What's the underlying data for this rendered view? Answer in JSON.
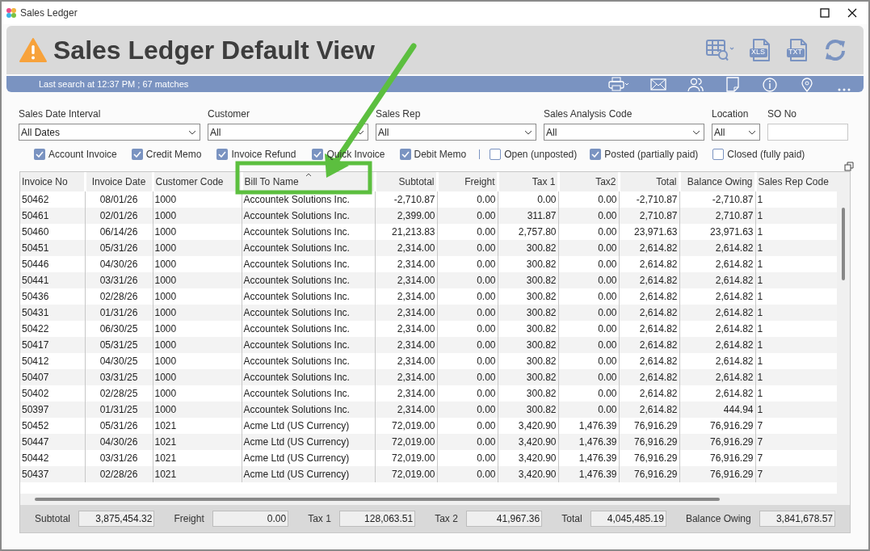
{
  "window": {
    "title": "Sales Ledger"
  },
  "header": {
    "title": "Sales Ledger Default View",
    "tools": [
      {
        "kind": "grid-search"
      },
      {
        "kind": "file",
        "label": "XLS"
      },
      {
        "kind": "file",
        "label": "TXT"
      },
      {
        "kind": "refresh"
      }
    ]
  },
  "status_bar": {
    "text": "Last search at 12:37 PM ; 67 matches",
    "tools": [
      {
        "kind": "printer"
      },
      {
        "kind": "mail"
      },
      {
        "kind": "people"
      },
      {
        "kind": "note"
      },
      {
        "kind": "info"
      },
      {
        "kind": "pin"
      },
      {
        "kind": "more"
      }
    ]
  },
  "filters": [
    {
      "label": "Sales Date Interval",
      "kind": "select",
      "value": "All Dates"
    },
    {
      "label": "Customer",
      "kind": "select",
      "value": "All"
    },
    {
      "label": "Sales Rep",
      "kind": "select",
      "value": "All"
    },
    {
      "label": "Sales Analysis Code",
      "kind": "select",
      "value": "All"
    },
    {
      "label": "Location",
      "kind": "select",
      "value": "All"
    },
    {
      "label": "SO No",
      "kind": "text"
    }
  ],
  "type_filters": [
    {
      "label": "Account Invoice",
      "checked": true
    },
    {
      "label": "Credit Memo",
      "checked": true
    },
    {
      "label": "Invoice Refund",
      "checked": true
    },
    {
      "label": "Quick Invoice",
      "checked": true
    },
    {
      "label": "Debit Memo",
      "checked": true
    }
  ],
  "status_filters": [
    {
      "label": "Open (unposted)",
      "checked": false
    },
    {
      "label": "Posted (partially paid)",
      "checked": true
    },
    {
      "label": "Closed (fully paid)",
      "checked": false
    }
  ],
  "table": {
    "columns": [
      {
        "label": "Invoice No",
        "sorted": false
      },
      {
        "label": "Invoice Date",
        "sorted": false
      },
      {
        "label": "Customer Code",
        "sorted": false
      },
      {
        "label": "Bill To Name",
        "sorted": true
      },
      {
        "label": "Subtotal",
        "sorted": false
      },
      {
        "label": "Freight",
        "sorted": false
      },
      {
        "label": "Tax 1",
        "sorted": false
      },
      {
        "label": "Tax2",
        "sorted": false
      },
      {
        "label": "Total",
        "sorted": false
      },
      {
        "label": "Balance Owing",
        "sorted": false
      },
      {
        "label": "Sales Rep Code",
        "sorted": false
      }
    ],
    "rows": [
      [
        "50462",
        "08/01/26",
        "1000",
        "Accountek Solutions Inc.",
        "-2,710.87",
        "0.00",
        "0.00",
        "0.00",
        "-2,710.87",
        "-2,710.87",
        "1"
      ],
      [
        "50461",
        "02/01/26",
        "1000",
        "Accountek Solutions Inc.",
        "2,399.00",
        "0.00",
        "311.87",
        "0.00",
        "2,710.87",
        "2,710.87",
        "1"
      ],
      [
        "50460",
        "06/14/26",
        "1000",
        "Accountek Solutions Inc.",
        "21,213.83",
        "0.00",
        "2,757.80",
        "0.00",
        "23,971.63",
        "23,971.63",
        "1"
      ],
      [
        "50451",
        "05/31/26",
        "1000",
        "Accountek Solutions Inc.",
        "2,314.00",
        "0.00",
        "300.82",
        "0.00",
        "2,614.82",
        "2,614.82",
        "1"
      ],
      [
        "50446",
        "04/30/26",
        "1000",
        "Accountek Solutions Inc.",
        "2,314.00",
        "0.00",
        "300.82",
        "0.00",
        "2,614.82",
        "2,614.82",
        "1"
      ],
      [
        "50441",
        "03/31/26",
        "1000",
        "Accountek Solutions Inc.",
        "2,314.00",
        "0.00",
        "300.82",
        "0.00",
        "2,614.82",
        "2,614.82",
        "1"
      ],
      [
        "50436",
        "02/28/26",
        "1000",
        "Accountek Solutions Inc.",
        "2,314.00",
        "0.00",
        "300.82",
        "0.00",
        "2,614.82",
        "2,614.82",
        "1"
      ],
      [
        "50431",
        "01/31/26",
        "1000",
        "Accountek Solutions Inc.",
        "2,314.00",
        "0.00",
        "300.82",
        "0.00",
        "2,614.82",
        "2,614.82",
        "1"
      ],
      [
        "50422",
        "06/30/25",
        "1000",
        "Accountek Solutions Inc.",
        "2,314.00",
        "0.00",
        "300.82",
        "0.00",
        "2,614.82",
        "2,614.82",
        "1"
      ],
      [
        "50417",
        "05/31/25",
        "1000",
        "Accountek Solutions Inc.",
        "2,314.00",
        "0.00",
        "300.82",
        "0.00",
        "2,614.82",
        "2,614.82",
        "1"
      ],
      [
        "50412",
        "04/30/25",
        "1000",
        "Accountek Solutions Inc.",
        "2,314.00",
        "0.00",
        "300.82",
        "0.00",
        "2,614.82",
        "2,614.82",
        "1"
      ],
      [
        "50407",
        "03/31/25",
        "1000",
        "Accountek Solutions Inc.",
        "2,314.00",
        "0.00",
        "300.82",
        "0.00",
        "2,614.82",
        "2,614.82",
        "1"
      ],
      [
        "50402",
        "02/28/25",
        "1000",
        "Accountek Solutions Inc.",
        "2,314.00",
        "0.00",
        "300.82",
        "0.00",
        "2,614.82",
        "2,614.82",
        "1"
      ],
      [
        "50397",
        "01/31/25",
        "1000",
        "Accountek Solutions Inc.",
        "2,314.00",
        "0.00",
        "300.82",
        "0.00",
        "2,614.82",
        "444.94",
        "1"
      ],
      [
        "50452",
        "05/31/26",
        "1021",
        "Acme Ltd (US Currency)",
        "72,019.00",
        "0.00",
        "3,420.90",
        "1,476.39",
        "76,916.29",
        "76,916.29",
        "7"
      ],
      [
        "50447",
        "04/30/26",
        "1021",
        "Acme Ltd (US Currency)",
        "72,019.00",
        "0.00",
        "3,420.90",
        "1,476.39",
        "76,916.29",
        "76,916.29",
        "7"
      ],
      [
        "50442",
        "03/31/26",
        "1021",
        "Acme Ltd (US Currency)",
        "72,019.00",
        "0.00",
        "3,420.90",
        "1,476.39",
        "76,916.29",
        "76,916.29",
        "7"
      ],
      [
        "50437",
        "02/28/26",
        "1021",
        "Acme Ltd (US Currency)",
        "72,019.00",
        "0.00",
        "3,420.90",
        "1,476.39",
        "76,916.29",
        "76,916.29",
        "7"
      ]
    ]
  },
  "totals": [
    {
      "label": "Subtotal",
      "value": "3,875,454.32"
    },
    {
      "label": "Freight",
      "value": "0.00"
    },
    {
      "label": "Tax 1",
      "value": "128,063.51"
    },
    {
      "label": "Tax 2",
      "value": "41,967.36"
    },
    {
      "label": "Total",
      "value": "4,045,485.19"
    },
    {
      "label": "Balance Owing",
      "value": "3,841,678.57"
    }
  ],
  "annotation": {
    "kind": "arrow-to-box"
  }
}
